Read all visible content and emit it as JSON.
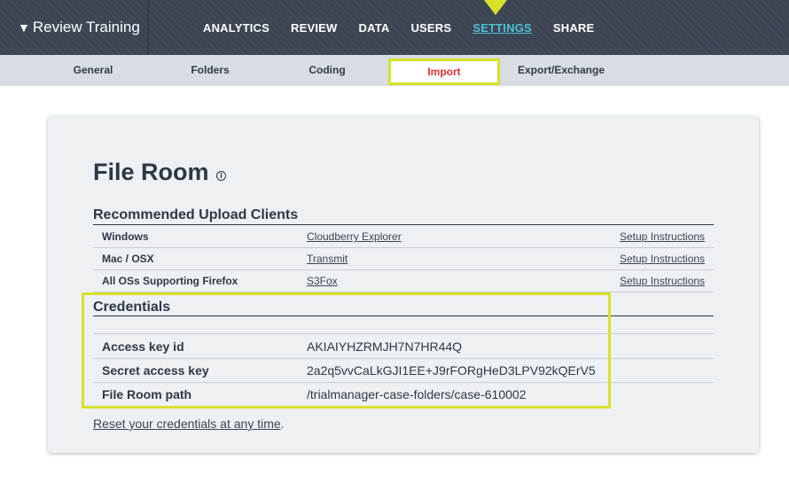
{
  "app": {
    "title": "Review Training"
  },
  "nav": {
    "items": [
      "ANALYTICS",
      "REVIEW",
      "DATA",
      "USERS",
      "SETTINGS",
      "SHARE"
    ],
    "active": "SETTINGS"
  },
  "subnav": {
    "items": [
      "General",
      "Folders",
      "Coding",
      "Import",
      "Export/Exchange"
    ],
    "active": "Import"
  },
  "page": {
    "title": "File Room",
    "info_icon": "i"
  },
  "upload_clients": {
    "title": "Recommended Upload Clients",
    "rows": [
      {
        "os": "Windows",
        "client": "Cloudberry Explorer",
        "setup": "Setup Instructions"
      },
      {
        "os": "Mac / OSX",
        "client": "Transmit",
        "setup": "Setup Instructions"
      },
      {
        "os": "All OSs Supporting Firefox",
        "client": "S3Fox",
        "setup": "Setup Instructions"
      }
    ]
  },
  "credentials": {
    "title": "Credentials",
    "rows": [
      {
        "label": "Access key id",
        "value": "AKIAIYHZRMJH7N7HR44Q"
      },
      {
        "label": "Secret access key",
        "value": "2a2q5vvCaLkGJI1EE+J9rFORgHeD3LPV92kQErV5"
      },
      {
        "label": "File Room path",
        "value": "/trialmanager-case-folders/case-610002"
      }
    ]
  },
  "reset": {
    "link_text": "Reset your credentials at any time",
    "suffix": "."
  },
  "colors": {
    "topbar": "#3a4452",
    "active_nav": "#4fc0d8",
    "highlight": "#d7e12a",
    "active_subnav_text": "#d9322f"
  }
}
